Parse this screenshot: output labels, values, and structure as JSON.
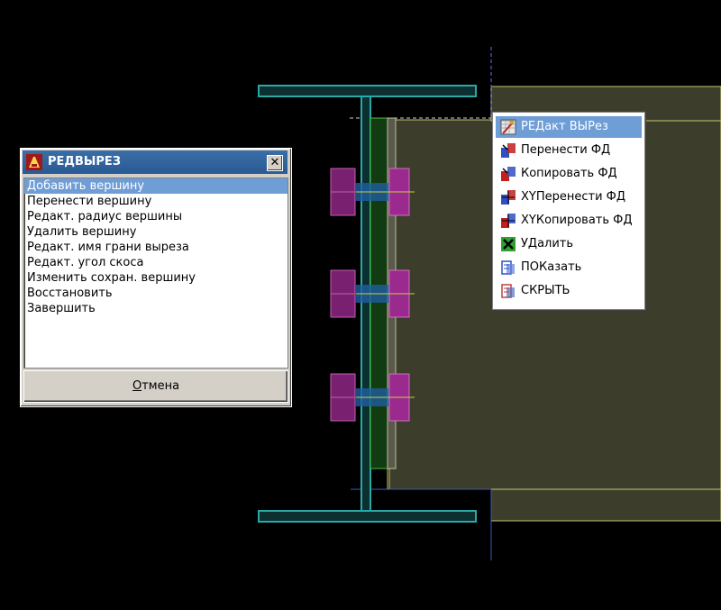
{
  "dialog": {
    "title": "РЕДВЫРЕЗ",
    "close_label": "✕",
    "items": [
      {
        "label": "Добавить вершину",
        "selected": true
      },
      {
        "label": "Перенести вершину"
      },
      {
        "label": "Редакт. радиус вершины"
      },
      {
        "label": "Удалить вершину"
      },
      {
        "label": "Редакт. имя грани выреза"
      },
      {
        "label": "Редакт. угол скоса"
      },
      {
        "label": "Изменить сохран. вершину"
      },
      {
        "label": "Восстановить"
      },
      {
        "label": "Завершить"
      }
    ],
    "cancel_label_first": "О",
    "cancel_label_rest": "тмена"
  },
  "context_menu": {
    "items": [
      {
        "label": "РЕДакт ВЫРез",
        "icon": "edit-cut-icon",
        "selected": true
      },
      {
        "label": "Перенести ФД",
        "icon": "move-icon"
      },
      {
        "label": "Копировать ФД",
        "icon": "copy-icon"
      },
      {
        "label": "XYПеренести ФД",
        "icon": "xy-move-icon"
      },
      {
        "label": "XYКопировать ФД",
        "icon": "xy-copy-icon"
      },
      {
        "label": "УДалить",
        "icon": "delete-icon"
      },
      {
        "label": "ПОКазать",
        "icon": "show-icon"
      },
      {
        "label": "СКРЫТЬ",
        "icon": "hide-icon"
      }
    ]
  },
  "colors": {
    "background": "#000000",
    "beam": "#2a9d9d",
    "plate": "#3d3d2c",
    "bolt": "#8b2a7a",
    "bolt_edge": "#c060b0",
    "weld": "#1f6b1f",
    "selection": "#6f9dd6",
    "title_bar": "#3a6ea5"
  }
}
